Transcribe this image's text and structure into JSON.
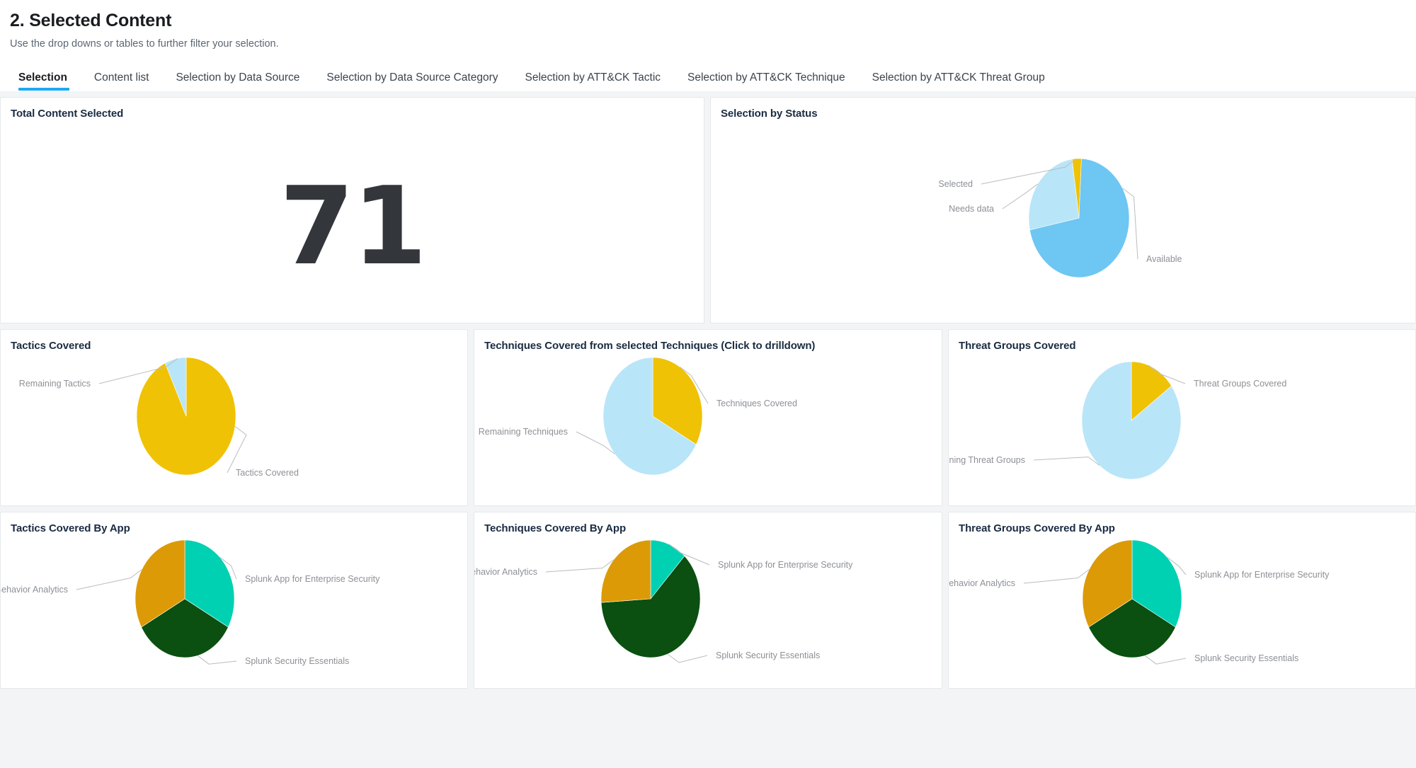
{
  "header": {
    "title": "2. Selected Content",
    "subtitle": "Use the drop downs or tables to further filter your selection."
  },
  "tabs": [
    {
      "label": "Selection",
      "active": true
    },
    {
      "label": "Content list",
      "active": false
    },
    {
      "label": "Selection by Data Source",
      "active": false
    },
    {
      "label": "Selection by Data Source Category",
      "active": false
    },
    {
      "label": "Selection by ATT&CK Tactic",
      "active": false
    },
    {
      "label": "Selection by ATT&CK Technique",
      "active": false
    },
    {
      "label": "Selection by ATT&CK Threat Group",
      "active": false
    }
  ],
  "colors": {
    "accent": "#1ca8f3",
    "light_blue": "#b9e5f8",
    "medium_blue": "#6ec6f2",
    "yellow": "#f0c205",
    "teal": "#00d1b2",
    "dark_green": "#0b4f11",
    "orange": "#dc9a07",
    "label_gray": "#8d9096",
    "title_navy": "#1a2b42"
  },
  "panels": {
    "total_content": {
      "title": "Total Content Selected",
      "value": "71"
    },
    "selection_by_status": {
      "title": "Selection by Status"
    },
    "tactics_covered": {
      "title": "Tactics Covered"
    },
    "techniques_covered": {
      "title": "Techniques Covered from selected Techniques (Click to drilldown)"
    },
    "threat_groups_covered": {
      "title": "Threat Groups Covered"
    },
    "tactics_by_app": {
      "title": "Tactics Covered By App"
    },
    "techniques_by_app": {
      "title": "Techniques Covered By App"
    },
    "threat_groups_by_app": {
      "title": "Threat Groups Covered By App"
    }
  },
  "chart_data": [
    {
      "id": "selection_by_status",
      "type": "pie",
      "title": "Selection by Status",
      "legend": "labeled-leaders",
      "labels": [
        "Selected",
        "Available",
        "Needs data"
      ],
      "values": [
        3,
        71,
        26
      ],
      "colors": [
        "#f0c205",
        "#6ec6f2",
        "#b9e5f8"
      ]
    },
    {
      "id": "tactics_covered",
      "type": "pie",
      "title": "Tactics Covered",
      "legend": "labeled-leaders",
      "labels": [
        "Tactics Covered",
        "Remaining Tactics"
      ],
      "values": [
        93,
        7
      ],
      "colors": [
        "#f0c205",
        "#b9e5f8"
      ]
    },
    {
      "id": "techniques_covered",
      "type": "pie",
      "title": "Techniques Covered from selected Techniques (Click to drilldown)",
      "legend": "labeled-leaders",
      "labels": [
        "Techniques Covered",
        "Remaining Techniques"
      ],
      "values": [
        33,
        67
      ],
      "colors": [
        "#f0c205",
        "#b9e5f8"
      ]
    },
    {
      "id": "threat_groups_covered",
      "type": "pie",
      "title": "Threat Groups Covered",
      "legend": "labeled-leaders",
      "labels": [
        "Threat Groups Covered",
        "Remaining Threat Groups"
      ],
      "values": [
        15,
        85
      ],
      "colors": [
        "#f0c205",
        "#b9e5f8"
      ]
    },
    {
      "id": "tactics_by_app",
      "type": "pie",
      "title": "Tactics Covered By App",
      "legend": "labeled-leaders",
      "labels": [
        "Splunk App for Enterprise Security",
        "Splunk Security Essentials",
        "Splunk User Behavior Analytics"
      ],
      "values": [
        33,
        34,
        33
      ],
      "colors": [
        "#00d1b2",
        "#0b4f11",
        "#dc9a07"
      ]
    },
    {
      "id": "techniques_by_app",
      "type": "pie",
      "title": "Techniques Covered By App",
      "legend": "labeled-leaders",
      "labels": [
        "Splunk App for Enterprise Security",
        "Splunk Security Essentials",
        "Splunk User Behavior Analytics"
      ],
      "values": [
        12,
        62,
        26
      ],
      "colors": [
        "#00d1b2",
        "#0b4f11",
        "#dc9a07"
      ]
    },
    {
      "id": "threat_groups_by_app",
      "type": "pie",
      "title": "Threat Groups Covered By App",
      "legend": "labeled-leaders",
      "labels": [
        "Splunk App for Enterprise Security",
        "Splunk Security Essentials",
        "Splunk User Behavior Analytics"
      ],
      "values": [
        33,
        34,
        33
      ],
      "colors": [
        "#00d1b2",
        "#0b4f11",
        "#dc9a07"
      ]
    }
  ]
}
